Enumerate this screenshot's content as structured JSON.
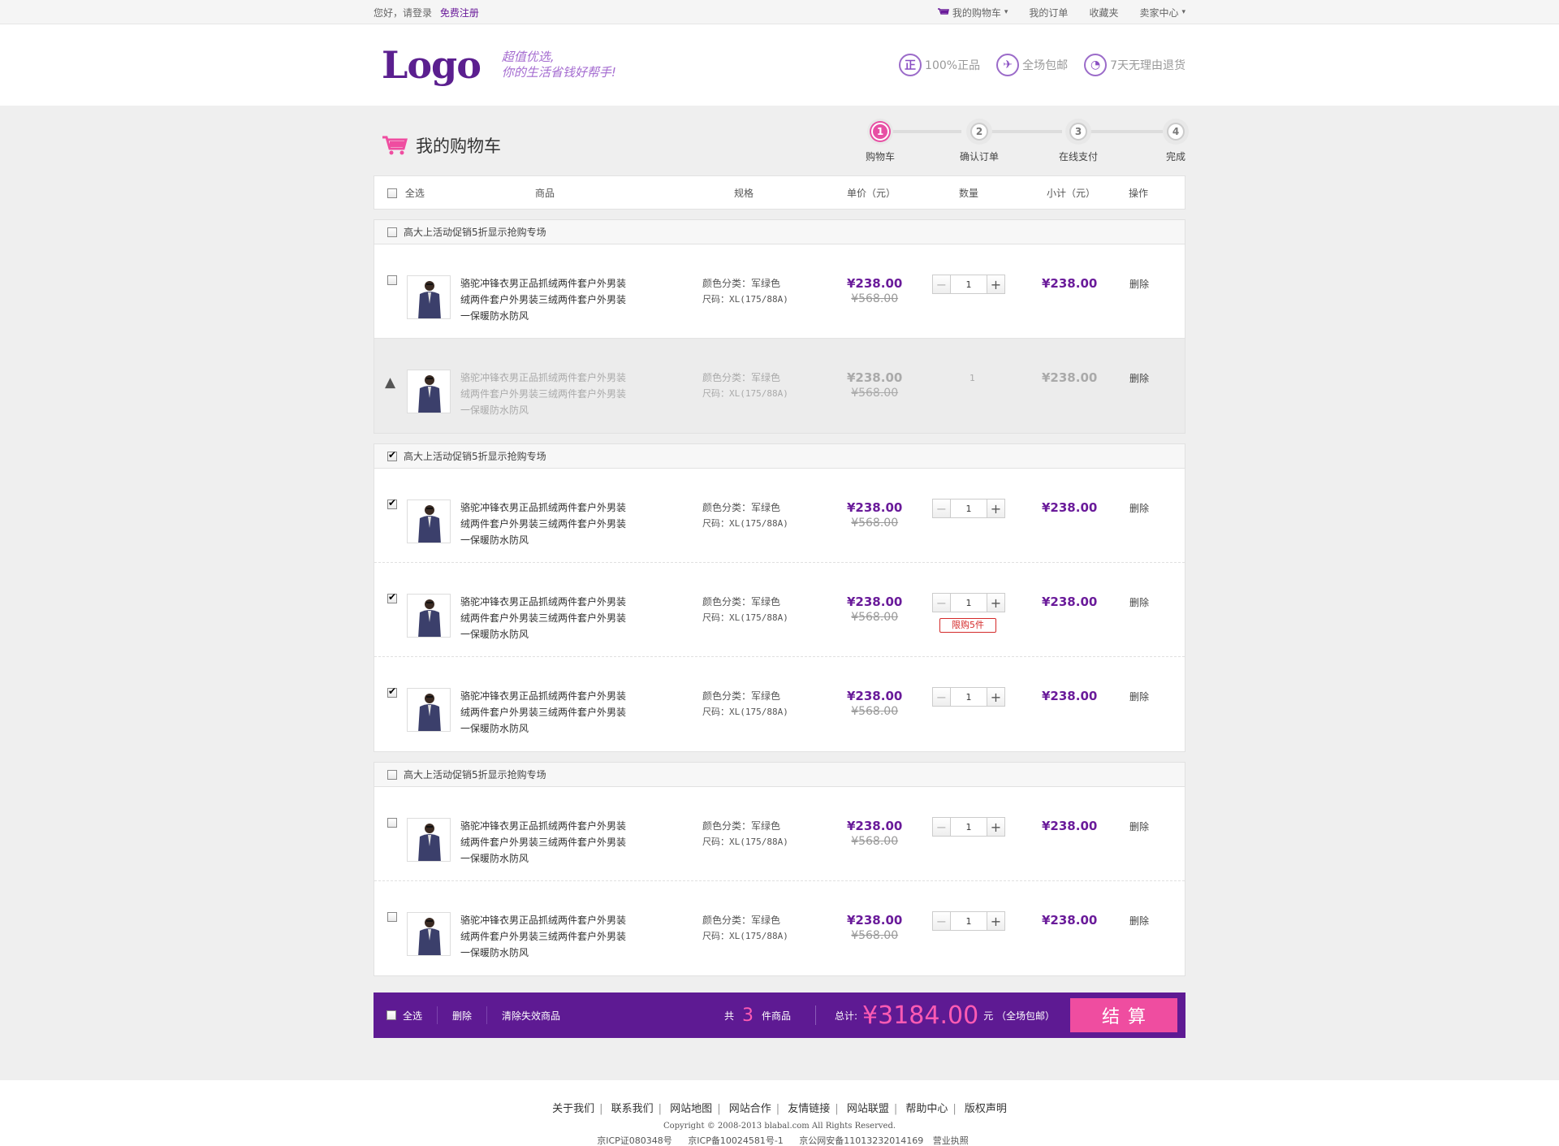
{
  "topbar": {
    "greeting": "您好，请登录",
    "register": "免费注册",
    "my_cart": "我的购物车",
    "my_orders": "我的订单",
    "favorites": "收藏夹",
    "seller_center": "卖家中心"
  },
  "header": {
    "logo": "Logo",
    "slogan_line1": "超值优选,",
    "slogan_line2": "你的生活省钱好帮手!",
    "guarantees": [
      {
        "icon": "正",
        "label": "100%正品"
      },
      {
        "icon": "邮",
        "label": "全场包邮"
      },
      {
        "icon": "7",
        "label": "7天无理由退货"
      }
    ]
  },
  "cart": {
    "title": "我的购物车",
    "steps": [
      {
        "num": "1",
        "label": "购物车"
      },
      {
        "num": "2",
        "label": "确认订单"
      },
      {
        "num": "3",
        "label": "在线支付"
      },
      {
        "num": "4",
        "label": "完成"
      }
    ],
    "columns": {
      "select_all": "全选",
      "product": "商品",
      "spec": "规格",
      "unit_price": "单价（元）",
      "qty": "数量",
      "subtotal": "小计（元）",
      "action": "操作"
    }
  },
  "item": {
    "name_l1": "骆驼冲锋衣男正品抓绒两件套户外男装",
    "name_l2": "绒两件套户外男装三绒两件套户外男装",
    "name_l3": "一保暖防水防风",
    "color": "颜色分类：军绿色",
    "size": "尺码：XL(175/88A)",
    "price": "¥238.00",
    "old_price": "¥568.00",
    "qty": "1",
    "subtotal": "¥238.00",
    "delete": "删除",
    "limit": "限购5件"
  },
  "groups": [
    {
      "title": "高大上活动促销5折显示抢购专场",
      "checked": false
    },
    {
      "title": "高大上活动促销5折显示抢购专场",
      "checked": true
    },
    {
      "title": "高大上活动促销5折显示抢购专场",
      "checked": false
    }
  ],
  "footer_bar": {
    "select_all": "全选",
    "delete": "删除",
    "clear_invalid": "清除失效商品",
    "count_prefix": "共",
    "count": "3",
    "count_suffix": "件商品",
    "total_label": "总计:",
    "total": "¥3184.00",
    "total_suffix": "元 （全场包邮）",
    "checkout": "结算"
  },
  "site_footer": {
    "links": [
      "关于我们",
      "联系我们",
      "网站地图",
      "网站合作",
      "友情链接",
      "网站联盟",
      "帮助中心",
      "版权声明"
    ],
    "copyright": "Copyright © 2008-2013 blabal.com All Rights Reserved.",
    "icp": [
      "京ICP证080348号",
      "京ICP备10024581号-1",
      "京公网安备11013232014169",
      "营业执照"
    ]
  },
  "colors": {
    "brand_purple": "#5e1a93",
    "accent_pink": "#ef4da0",
    "price_purple": "#6a1b9a"
  }
}
